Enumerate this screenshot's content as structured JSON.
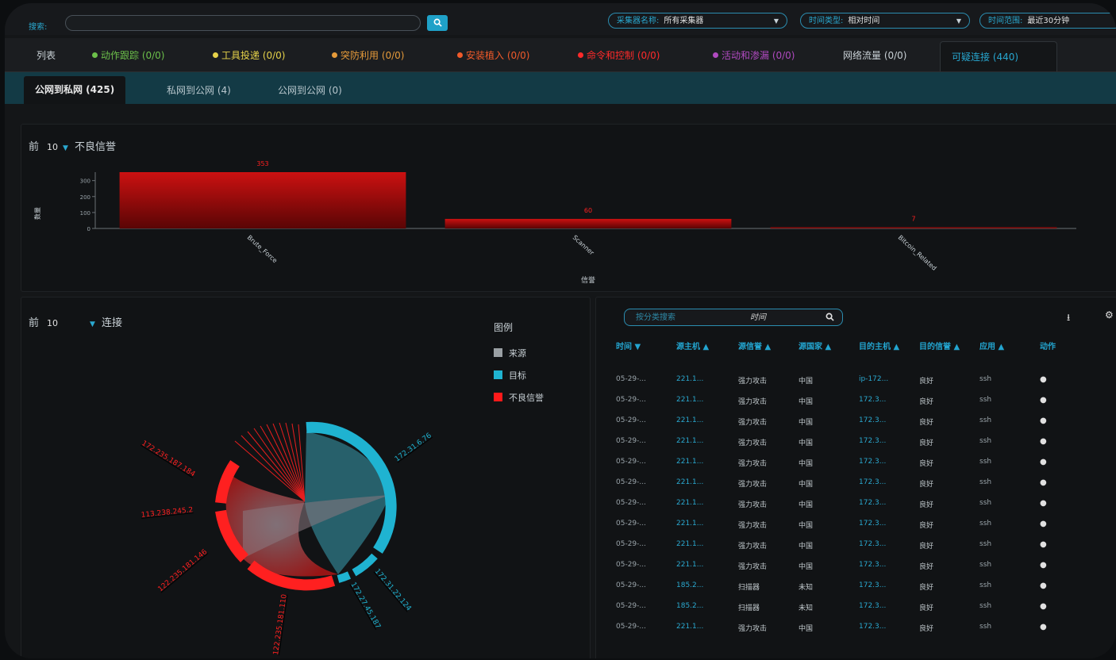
{
  "toolbar": {
    "search_label": "搜索:",
    "search_button_icon": "search-icon",
    "collector": {
      "key": "采集器名称:",
      "value": "所有采集器"
    },
    "time_type": {
      "key": "时间类型:",
      "value": "相对时间"
    },
    "time_range": {
      "key": "时间范围:",
      "value": "最近30分钟"
    }
  },
  "main_tabs": [
    {
      "label": "列表",
      "color": "#c9d1d6"
    },
    {
      "label": "动作跟踪 (0/0)",
      "color": "#6cc04a"
    },
    {
      "label": "工具投递 (0/0)",
      "color": "#e7d34a"
    },
    {
      "label": "突防利用 (0/0)",
      "color": "#e59a3a"
    },
    {
      "label": "安装植入 (0/0)",
      "color": "#f05a2a"
    },
    {
      "label": "命令和控制 (0/0)",
      "color": "#ff2a2a"
    },
    {
      "label": "活动和渗漏 (0/0)",
      "color": "#b04ac0"
    },
    {
      "label": "网络流量 (0/0)",
      "color": "#c9d1d6"
    },
    {
      "label": "可疑连接 (440)",
      "color": "#27a6cf"
    }
  ],
  "sub_tabs": [
    {
      "label": "公网到私网 (425)"
    },
    {
      "label": "私网到公网 (4)"
    },
    {
      "label": "公网到公网 (0)"
    }
  ],
  "bar_panel": {
    "prefix": "前",
    "count": "10",
    "title": "不良信誉"
  },
  "chord_panel": {
    "prefix": "前",
    "count": "10",
    "title": "连接",
    "legend_title": "图例",
    "legend": [
      {
        "label": "来源",
        "color": "#9aa0a4"
      },
      {
        "label": "目标",
        "color": "#1fb3d1"
      },
      {
        "label": "不良信誉",
        "color": "#ff1a1a"
      }
    ],
    "labels": {
      "target_1": "172.31.6.76",
      "source_1": "172.235.187.184",
      "source_2": "113.238.245.2",
      "source_3": "122.235.181.146",
      "source_4": "122.235.181.110",
      "target_2": "172.31.22.124",
      "target_3": "172.27.45.187"
    }
  },
  "chart_data": {
    "type": "bar",
    "categories": [
      "Brute_Force",
      "Scanner",
      "Bitcoin_Related"
    ],
    "values": [
      353,
      60,
      7
    ],
    "ylabel": "数量",
    "xlabel": "信誉",
    "yticks": [
      0,
      100,
      200,
      300
    ],
    "ylim": [
      0,
      353
    ],
    "color": "#cc1111"
  },
  "table": {
    "search_placeholder": "按分类搜索",
    "search_field": "时间",
    "headers": [
      "时间 ▼",
      "源主机 ▲",
      "源信誉 ▲",
      "源国家 ▲",
      "目的主机 ▲",
      "目的信誉 ▲",
      "应用 ▲",
      "动作"
    ],
    "rows": [
      {
        "time": "05-29-...",
        "src": "221.1...",
        "rep": "强力攻击",
        "country": "中国",
        "dst": "ip-172...",
        "drep": "良好",
        "app": "ssh"
      },
      {
        "time": "05-29-...",
        "src": "221.1...",
        "rep": "强力攻击",
        "country": "中国",
        "dst": "172.3...",
        "drep": "良好",
        "app": "ssh"
      },
      {
        "time": "05-29-...",
        "src": "221.1...",
        "rep": "强力攻击",
        "country": "中国",
        "dst": "172.3...",
        "drep": "良好",
        "app": "ssh"
      },
      {
        "time": "05-29-...",
        "src": "221.1...",
        "rep": "强力攻击",
        "country": "中国",
        "dst": "172.3...",
        "drep": "良好",
        "app": "ssh"
      },
      {
        "time": "05-29-...",
        "src": "221.1...",
        "rep": "强力攻击",
        "country": "中国",
        "dst": "172.3...",
        "drep": "良好",
        "app": "ssh"
      },
      {
        "time": "05-29-...",
        "src": "221.1...",
        "rep": "强力攻击",
        "country": "中国",
        "dst": "172.3...",
        "drep": "良好",
        "app": "ssh"
      },
      {
        "time": "05-29-...",
        "src": "221.1...",
        "rep": "强力攻击",
        "country": "中国",
        "dst": "172.3...",
        "drep": "良好",
        "app": "ssh"
      },
      {
        "time": "05-29-...",
        "src": "221.1...",
        "rep": "强力攻击",
        "country": "中国",
        "dst": "172.3...",
        "drep": "良好",
        "app": "ssh"
      },
      {
        "time": "05-29-...",
        "src": "221.1...",
        "rep": "强力攻击",
        "country": "中国",
        "dst": "172.3...",
        "drep": "良好",
        "app": "ssh"
      },
      {
        "time": "05-29-...",
        "src": "221.1...",
        "rep": "强力攻击",
        "country": "中国",
        "dst": "172.3...",
        "drep": "良好",
        "app": "ssh"
      },
      {
        "time": "05-29-...",
        "src": "185.2...",
        "rep": "扫描器",
        "country": "未知",
        "dst": "172.3...",
        "drep": "良好",
        "app": "ssh"
      },
      {
        "time": "05-29-...",
        "src": "185.2...",
        "rep": "扫描器",
        "country": "未知",
        "dst": "172.3...",
        "drep": "良好",
        "app": "ssh"
      },
      {
        "time": "05-29-...",
        "src": "221.1...",
        "rep": "强力攻击",
        "country": "中国",
        "dst": "172.3...",
        "drep": "良好",
        "app": "ssh"
      }
    ]
  }
}
